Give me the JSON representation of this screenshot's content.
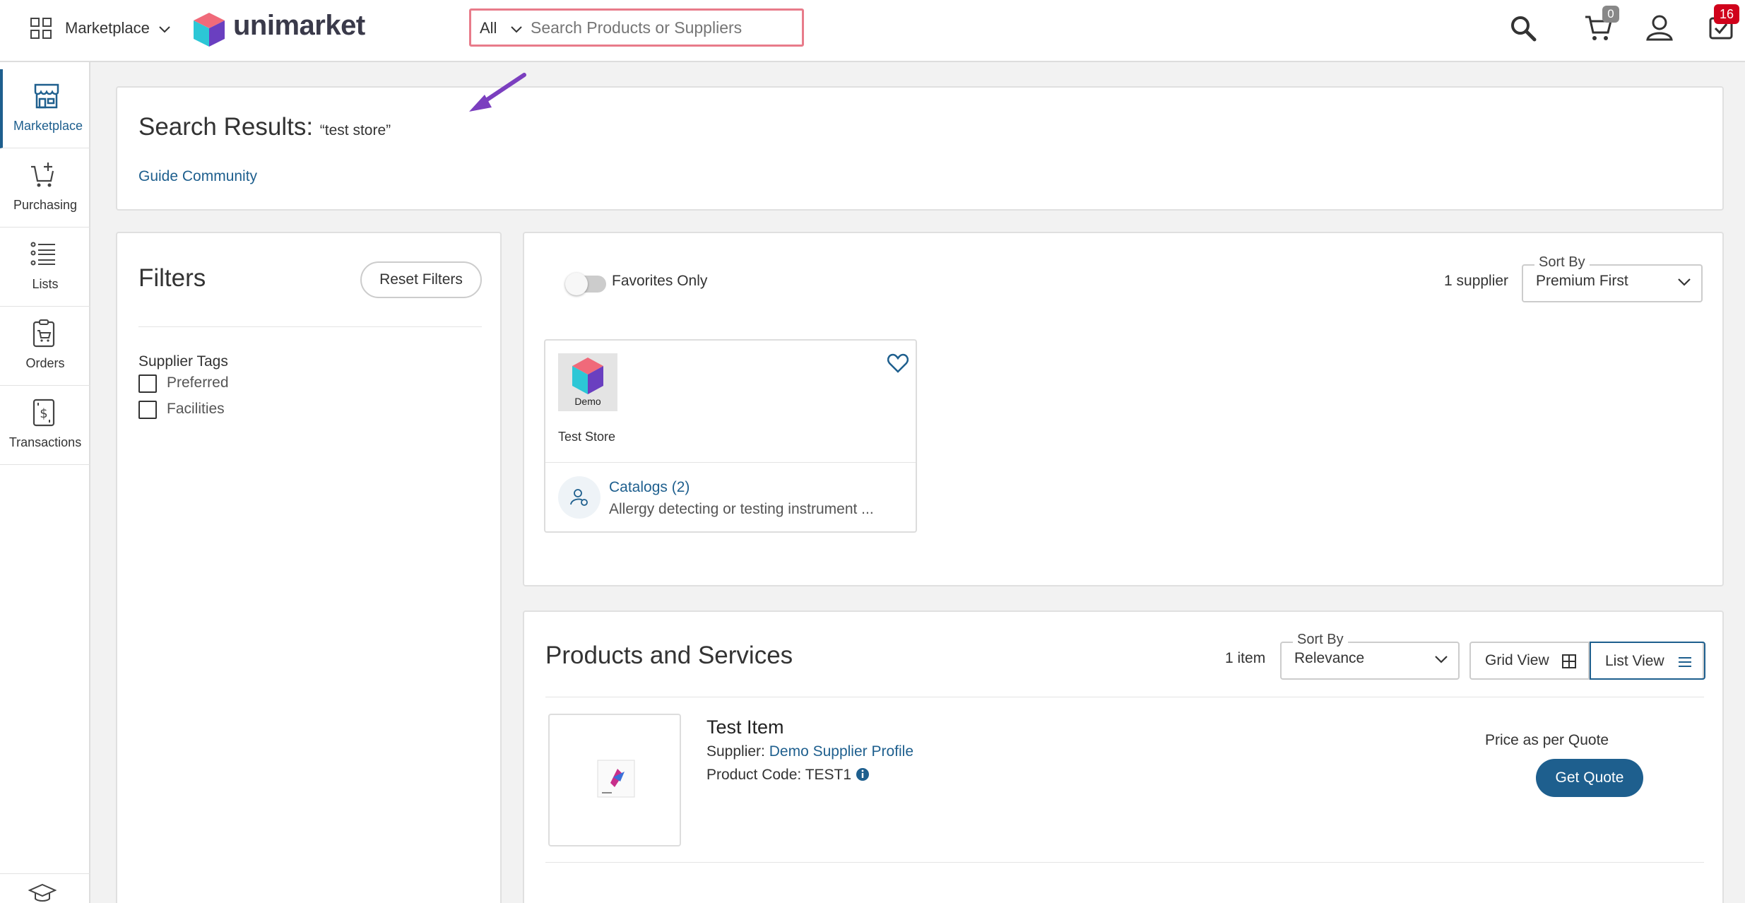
{
  "header": {
    "app_switch_label": "Marketplace",
    "logo_text": "unimarket",
    "search_scope": "All",
    "search_placeholder": "Search Products or Suppliers",
    "cart_count": "0",
    "tasks_count": "16"
  },
  "sidebar": {
    "items": [
      {
        "label": "Marketplace",
        "active": true
      },
      {
        "label": "Purchasing"
      },
      {
        "label": "Lists"
      },
      {
        "label": "Orders"
      },
      {
        "label": "Transactions"
      }
    ]
  },
  "results": {
    "title": "Search Results:",
    "query": "“test store”",
    "guide_link": "Guide Community"
  },
  "filters": {
    "title": "Filters",
    "reset_label": "Reset Filters",
    "tags_title": "Supplier Tags",
    "tags": [
      "Preferred",
      "Facilities"
    ]
  },
  "suppliers": {
    "favorites_label": "Favorites Only",
    "count": "1 supplier",
    "sort_legend": "Sort By",
    "sort_value": "Premium First",
    "card": {
      "logo_text": "Demo",
      "name": "Test Store",
      "catalogs_link": "Catalogs (2)",
      "catalog_desc": "Allergy detecting or testing instrument ..."
    }
  },
  "products": {
    "title": "Products and Services",
    "count": "1 item",
    "sort_legend": "Sort By",
    "sort_value": "Relevance",
    "grid_view_label": "Grid View",
    "list_view_label": "List View",
    "item": {
      "name": "Test Item",
      "supplier_label": "Supplier:",
      "supplier_link": "Demo Supplier Profile",
      "code_label": "Product Code: TEST1",
      "price_text": "Price as per Quote",
      "quote_button": "Get Quote"
    }
  },
  "colors": {
    "accent": "#1e5f8e",
    "search_border": "#e87b8a",
    "badge_red": "#d0021b",
    "arrow": "#7b3fbf"
  }
}
